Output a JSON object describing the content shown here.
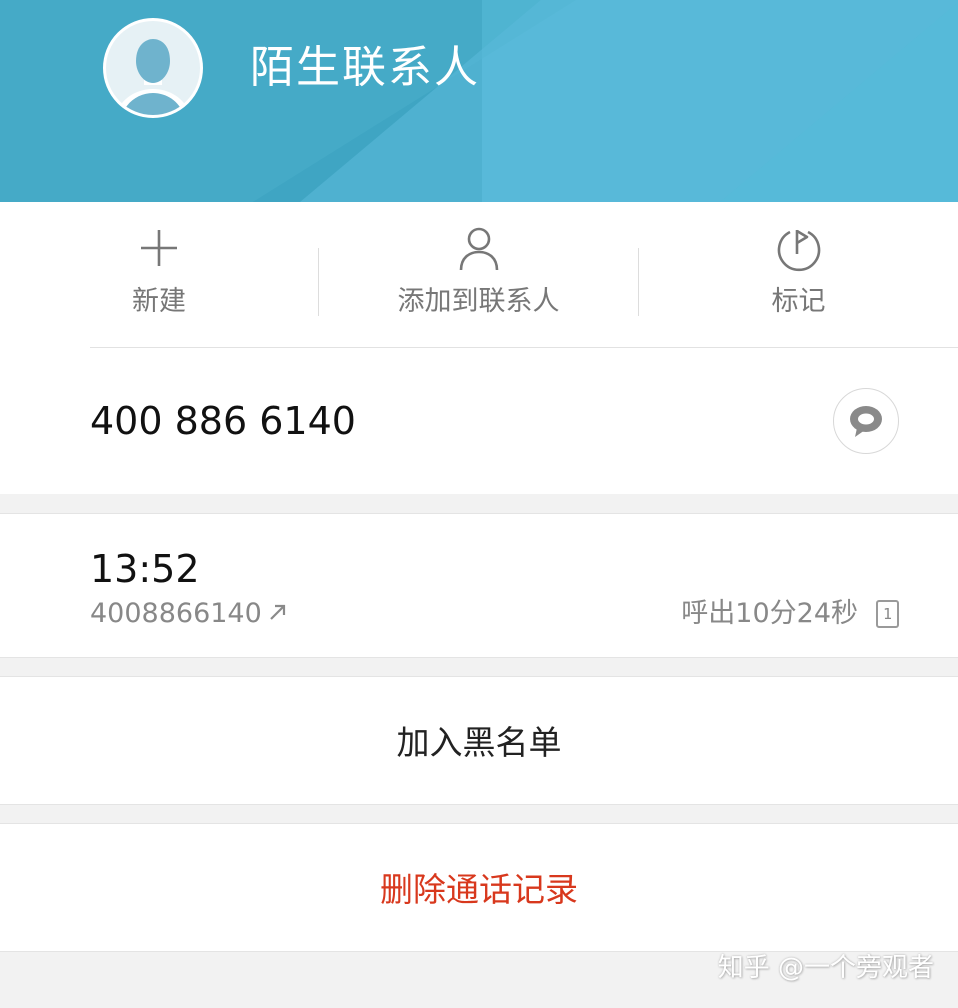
{
  "header": {
    "contact_name": "陌生联系人",
    "avatar_icon": "person-silhouette-icon",
    "colors": {
      "banner": "#56bad9",
      "banner_dark": "#3fa5c3"
    }
  },
  "actions": [
    {
      "label": "新建",
      "icon": "plus-icon"
    },
    {
      "label": "添加到联系人",
      "icon": "person-icon"
    },
    {
      "label": "标记",
      "icon": "flag-icon"
    }
  ],
  "phone": {
    "number": "400 886 6140",
    "message_icon": "message-bubble-icon"
  },
  "call_log": {
    "time": "13:52",
    "number": "4008866140",
    "direction_icon": "outgoing-arrow-icon",
    "detail": "呼出10分24秒",
    "sim": "1"
  },
  "block": {
    "label": "加入黑名单"
  },
  "delete": {
    "label": "删除通话记录",
    "color": "#d8381d"
  },
  "watermark": "知乎 @一个旁观者"
}
